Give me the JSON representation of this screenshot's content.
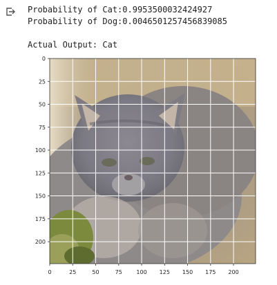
{
  "output": {
    "lines": [
      "Probability of Cat:0.9953500032424927",
      "Probability of Dog:0.0046501257456839085",
      "",
      "Actual Output: Cat"
    ]
  },
  "icons": {
    "output_icon": "output-arrow-icon"
  },
  "image_plot": {
    "x_ticks": [
      "0",
      "25",
      "50",
      "75",
      "100",
      "125",
      "150",
      "175",
      "200"
    ],
    "y_ticks": [
      "0",
      "25",
      "50",
      "75",
      "100",
      "125",
      "150",
      "175",
      "200"
    ],
    "xlim": [
      0,
      224
    ],
    "ylim": [
      224,
      0
    ],
    "grid": true
  }
}
